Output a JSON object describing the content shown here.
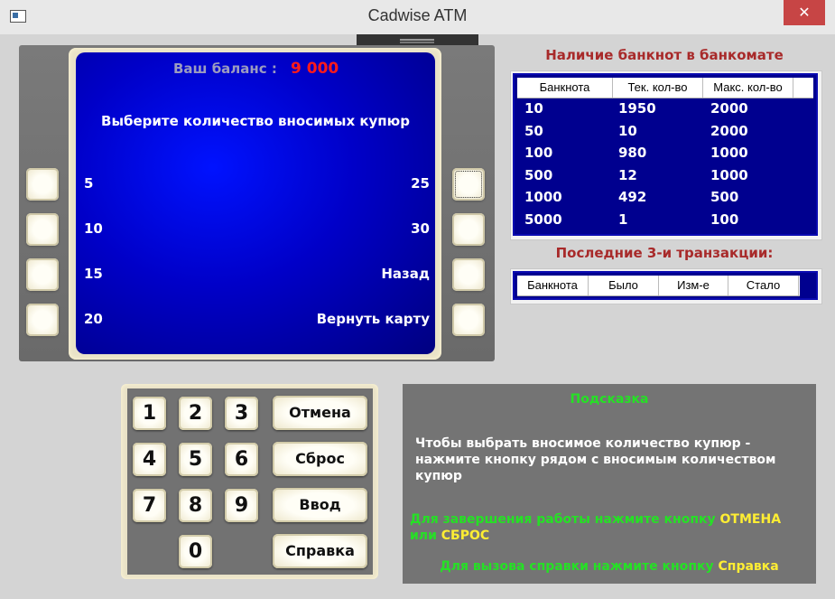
{
  "window": {
    "title": "Cadwise ATM",
    "close_glyph": "✕"
  },
  "screen": {
    "balance_label": "Ваш баланс :",
    "balance_value": "9 000",
    "prompt": "Выберите количество вносимых купюр",
    "left_options": [
      "5",
      "10",
      "15",
      "20"
    ],
    "right_options": [
      "25",
      "30",
      "Назад",
      "Вернуть карту"
    ]
  },
  "banknotes": {
    "title": "Наличие банкнот в банкомате",
    "columns": [
      "Банкнота",
      "Тек. кол-во",
      "Макс. кол-во"
    ],
    "rows": [
      [
        "10",
        "1950",
        "2000"
      ],
      [
        "50",
        "10",
        "2000"
      ],
      [
        "100",
        "980",
        "1000"
      ],
      [
        "500",
        "12",
        "1000"
      ],
      [
        "1000",
        "492",
        "500"
      ],
      [
        "5000",
        "1",
        "100"
      ]
    ]
  },
  "transactions": {
    "title": "Последние 3-и транзакции:",
    "columns": [
      "Банкнота",
      "Было",
      "Изм-е",
      "Стало"
    ]
  },
  "keypad": {
    "digits": [
      "1",
      "2",
      "3",
      "4",
      "5",
      "6",
      "7",
      "8",
      "9",
      "0"
    ],
    "cancel": "Отмена",
    "reset": "Сброс",
    "enter": "Ввод",
    "help": "Справка"
  },
  "hint": {
    "title": "Подсказка",
    "text": "Чтобы выбрать вносимое количество купюр - нажмите кнопку рядом с вносимым количеством купюр",
    "line1_a": "Для завершения работы нажмите кнопку ",
    "line1_b": "ОТМЕНА",
    "line1_c": "или ",
    "line1_d": "СБРОС",
    "line2_a": "Для вызова справки нажмите кнопку ",
    "line2_b": "Справка"
  },
  "colors": {
    "screen": "#0000c8",
    "balance": "#ff1a1a",
    "section_title": "#a82a2a",
    "hint_green": "#25e125",
    "hint_yellow": "#ffee33"
  }
}
